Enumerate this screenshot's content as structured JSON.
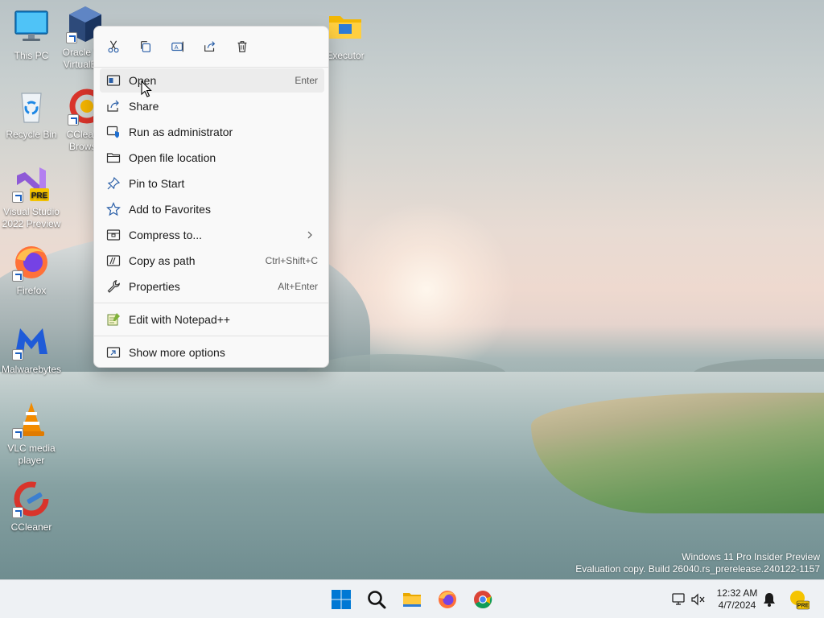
{
  "desktop": {
    "icons": [
      {
        "label": "This PC"
      },
      {
        "label": "Oracle VM VirtualBox"
      },
      {
        "label": "Recycle Bin"
      },
      {
        "label": "CCleaner Browser"
      },
      {
        "label": "Visual Studio 2022 Preview",
        "badge": "PRE"
      },
      {
        "label": "Firefox"
      },
      {
        "label": "Malwarebytes"
      },
      {
        "label": "VLC media player"
      },
      {
        "label": "CCleaner"
      },
      {
        "label": "Executor"
      }
    ],
    "watermark": {
      "line1": "Windows 11 Pro Insider Preview",
      "line2": "Evaluation copy. Build 26040.rs_prerelease.240122-1157"
    }
  },
  "context_menu": {
    "toolbar": [
      {
        "icon": "cut-icon",
        "tooltip": "Cut"
      },
      {
        "icon": "copy-icon",
        "tooltip": "Copy"
      },
      {
        "icon": "rename-icon",
        "tooltip": "Rename"
      },
      {
        "icon": "share-icon",
        "tooltip": "Share"
      },
      {
        "icon": "delete-icon",
        "tooltip": "Delete"
      }
    ],
    "items": [
      {
        "label": "Open",
        "shortcut": "Enter",
        "icon": "open-icon"
      },
      {
        "label": "Share",
        "shortcut": "",
        "icon": "share-icon"
      },
      {
        "label": "Run as administrator",
        "shortcut": "",
        "icon": "shield-icon"
      },
      {
        "label": "Open file location",
        "shortcut": "",
        "icon": "folder-icon"
      },
      {
        "label": "Pin to Start",
        "shortcut": "",
        "icon": "pin-icon"
      },
      {
        "label": "Add to Favorites",
        "shortcut": "",
        "icon": "star-icon"
      },
      {
        "label": "Compress to...",
        "shortcut": "",
        "icon": "archive-icon",
        "submenu": true
      },
      {
        "label": "Copy as path",
        "shortcut": "Ctrl+Shift+C",
        "icon": "path-icon"
      },
      {
        "label": "Properties",
        "shortcut": "Alt+Enter",
        "icon": "wrench-icon"
      },
      {
        "label": "Edit with Notepad++",
        "shortcut": "",
        "icon": "notepad-icon"
      },
      {
        "label": "Show more options",
        "shortcut": "",
        "icon": "more-options-icon"
      }
    ]
  },
  "taskbar": {
    "apps": [
      {
        "name": "Start",
        "icon": "windows-icon"
      },
      {
        "name": "Search",
        "icon": "search-icon"
      },
      {
        "name": "File Explorer",
        "icon": "folder-icon"
      },
      {
        "name": "Firefox",
        "icon": "firefox-icon"
      },
      {
        "name": "Chrome",
        "icon": "chrome-icon"
      }
    ],
    "tray": {
      "time": "12:32 AM",
      "date": "4/7/2024",
      "dev_badge": "PRE"
    }
  },
  "colors": {
    "accent": "#0067c0",
    "menu_bg": "#f9f9f9",
    "taskbar_bg": "#eef1f4"
  }
}
